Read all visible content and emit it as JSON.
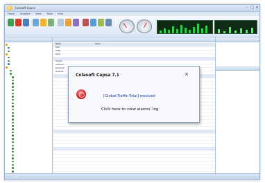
{
  "window": {
    "title": "Colasoft Capsa"
  },
  "menu": {
    "tabs": [
      "Home",
      "Analysis",
      "View",
      "Tools",
      "Help"
    ]
  },
  "center": {
    "rows": [
      {
        "name": "Name",
        "value": "Value"
      },
      {
        "name": "Total",
        "value": ""
      },
      {
        "name": "Traffic",
        "value": ""
      },
      {
        "name": "Bytes",
        "value": ""
      },
      {
        "name": "Packets",
        "value": ""
      },
      {
        "name": "Utilization",
        "value": ""
      },
      {
        "name": "Broadcast",
        "value": ""
      },
      {
        "name": "Multicast",
        "value": ""
      }
    ]
  },
  "popup": {
    "title": "Colasoft Capsa 7.1",
    "message": "[Global-Traffic-Total] resolved",
    "link": "Click here to view alarms' log",
    "close": "×"
  },
  "colors": {
    "accent": "#1a3fa3",
    "alarm_icon": "#d11b1b",
    "graph": "#2bd04a"
  },
  "icons": {
    "app": "capsa-logo-icon",
    "alarm": "alarm-icon",
    "close": "close-icon"
  }
}
